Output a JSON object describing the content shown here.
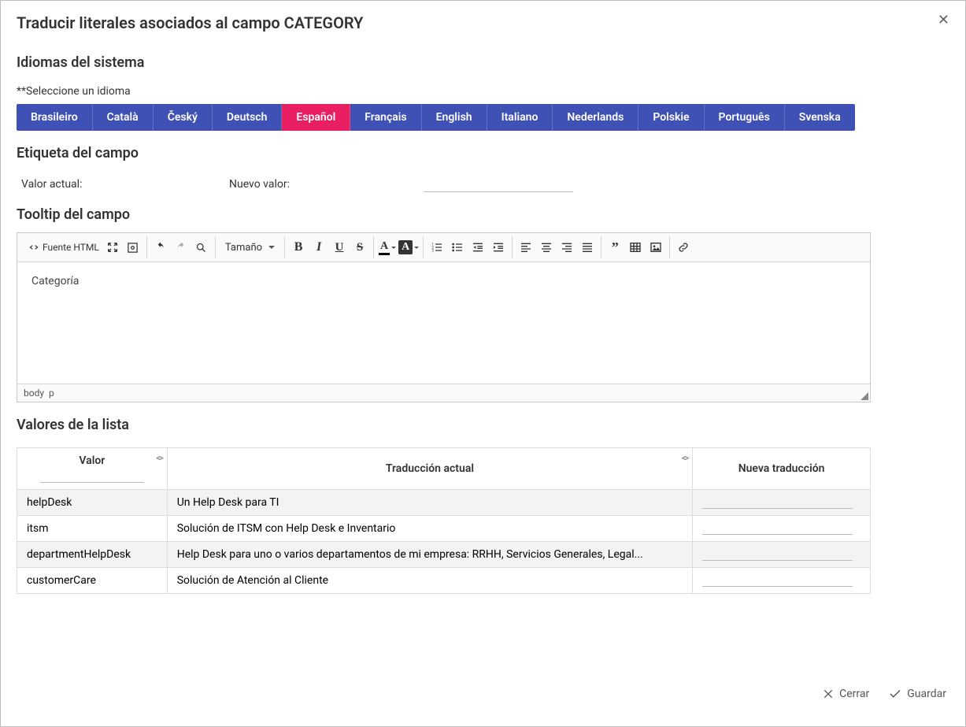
{
  "dialog": {
    "title": "Traducir literales asociados al campo CATEGORY"
  },
  "sections": {
    "languages_title": "Idiomas del sistema",
    "select_language_note": "**Seleccione un idioma",
    "field_label_title": "Etiqueta del campo",
    "current_value_label": "Valor actual:",
    "new_value_label": "Nuevo valor:",
    "tooltip_title": "Tooltip del campo",
    "list_values_title": "Valores de la lista"
  },
  "languages": [
    "Brasileiro",
    "Català",
    "Český",
    "Deutsch",
    "Español",
    "Français",
    "English",
    "Italiano",
    "Nederlands",
    "Polskie",
    "Português",
    "Svenska"
  ],
  "active_language": "Español",
  "editor": {
    "source_label": "Fuente HTML",
    "size_label": "Tamaño",
    "content": "Categoría",
    "path": [
      "body",
      "p"
    ]
  },
  "table": {
    "headers": {
      "value": "Valor",
      "current": "Traducción actual",
      "new": "Nueva traducción"
    },
    "rows": [
      {
        "value": "helpDesk",
        "current": "Un Help Desk para TI"
      },
      {
        "value": "itsm",
        "current": "Solución de ITSM con Help Desk e Inventario"
      },
      {
        "value": "departmentHelpDesk",
        "current": "Help Desk para uno o varios departamentos de mi empresa: RRHH, Servicios Generales, Legal..."
      },
      {
        "value": "customerCare",
        "current": "Solución de Atención al Cliente"
      }
    ]
  },
  "footer": {
    "close": "Cerrar",
    "save": "Guardar"
  }
}
